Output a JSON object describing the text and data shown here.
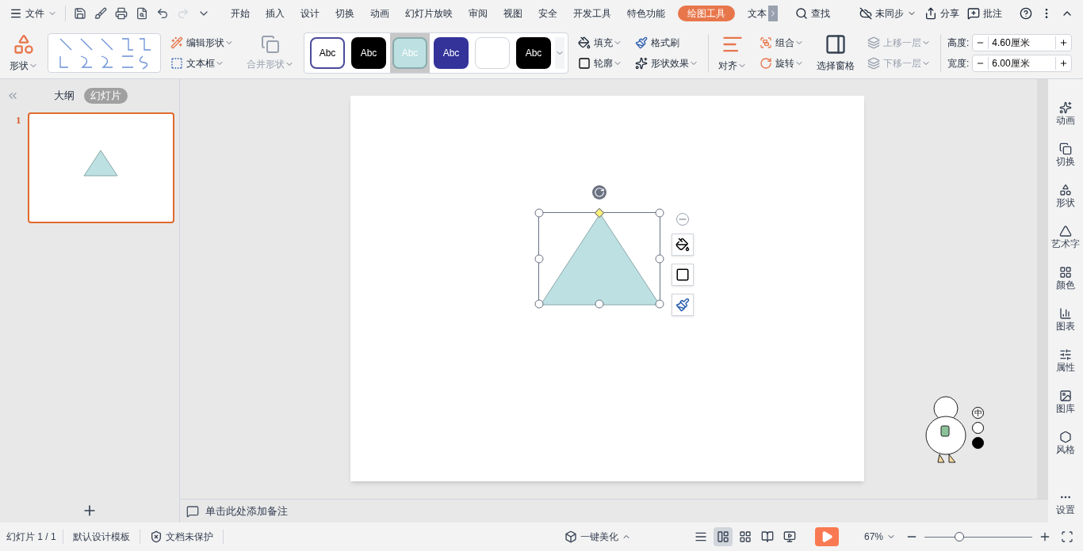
{
  "menu": {
    "file": "文件",
    "tabs": [
      {
        "label": "开始",
        "selected": false
      },
      {
        "label": "插入",
        "selected": false
      },
      {
        "label": "设计",
        "selected": false
      },
      {
        "label": "切换",
        "selected": false
      },
      {
        "label": "动画",
        "selected": false
      },
      {
        "label": "幻灯片放映",
        "selected": false
      },
      {
        "label": "审阅",
        "selected": false
      },
      {
        "label": "视图",
        "selected": false
      },
      {
        "label": "安全",
        "selected": false
      },
      {
        "label": "开发工具",
        "selected": false
      },
      {
        "label": "特色功能",
        "selected": false
      },
      {
        "label": "绘图工具",
        "selected": true
      },
      {
        "label": "文本",
        "selected": false
      }
    ],
    "search": "查找",
    "sync": "未同步",
    "share": "分享",
    "comment": "批注"
  },
  "ribbon": {
    "shape": "形状",
    "edit_shape": "编辑形状",
    "text_box": "文本框",
    "merge_shapes": {
      "label": "合并形状",
      "disabled": true
    },
    "style_presets": [
      {
        "kind": "outline",
        "label": "Abc",
        "color": "#ffffff",
        "selected": false
      },
      {
        "kind": "filled",
        "label": "Abc",
        "color": "#000000",
        "selected": false
      },
      {
        "kind": "filled",
        "label": "Abc",
        "color": "#bde0e2",
        "selected": true
      },
      {
        "kind": "filled",
        "label": "Abc",
        "color": "#33339a",
        "selected": false
      },
      {
        "kind": "blank",
        "color": "#ffffff",
        "selected": false
      },
      {
        "kind": "filled",
        "label": "Abc",
        "color": "#000000",
        "selected": false
      }
    ],
    "fill": "填充",
    "format_painter": "格式刷",
    "outline": "轮廓",
    "shape_effects": "形状效果",
    "align": "对齐",
    "group": "组合",
    "rotate": "旋转",
    "selection_pane": "选择窗格",
    "bring_forward": {
      "label": "上移一层",
      "disabled": true
    },
    "send_backward": {
      "label": "下移一层",
      "disabled": true
    },
    "height": {
      "label": "高度:",
      "value": "4.60厘米"
    },
    "width": {
      "label": "宽度:",
      "value": "6.00厘米"
    }
  },
  "slide_panel": {
    "tabs": [
      {
        "label": "大纲",
        "selected": false
      },
      {
        "label": "幻灯片",
        "selected": true
      }
    ],
    "slides": [
      {
        "number": "1",
        "selected": true
      }
    ]
  },
  "notes": {
    "placeholder": "单击此处添加备注"
  },
  "ime": "中",
  "right_sidebar": {
    "items": [
      "动画",
      "切换",
      "形状",
      "艺术字",
      "颜色",
      "图表",
      "属性",
      "图库",
      "风格"
    ],
    "settings": "设置"
  },
  "status_bar": {
    "slide": "幻灯片 1 / 1",
    "template": "默认设计模板",
    "protection": "文档未保护",
    "beautify": "一键美化",
    "zoom": "67%",
    "zoom_slider": {
      "level": 0.32
    }
  }
}
